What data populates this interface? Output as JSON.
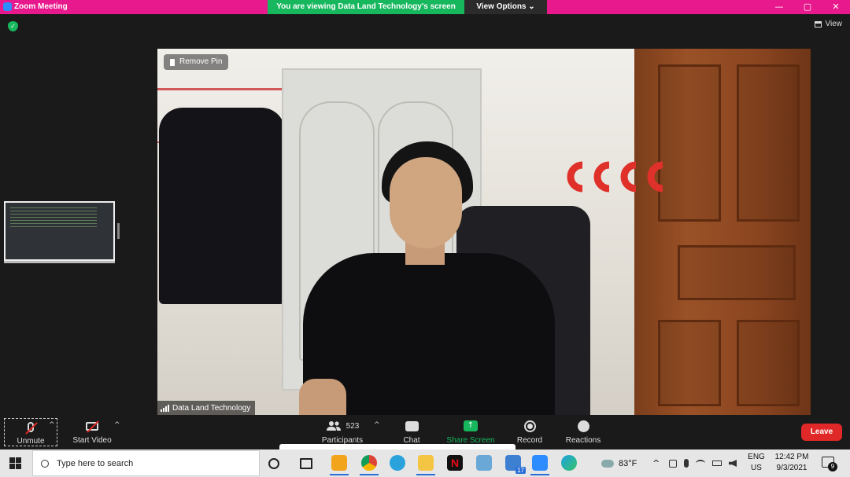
{
  "titlebar": {
    "title": "Zoom Meeting",
    "banner": "You are viewing Data Land Technology's screen",
    "view_options": "View Options",
    "view_options_caret": "⌄",
    "controls": [
      "—",
      "▢",
      "✕"
    ]
  },
  "meeting": {
    "view_label": "View",
    "remove_pin": "Remove Pin",
    "active_speaker": "Data Land Technology"
  },
  "toolbar": {
    "unmute": "Unmute",
    "start_video": "Start Video",
    "participants_count": "523",
    "participants": "Participants",
    "chat": "Chat",
    "share_screen": "Share Screen",
    "record": "Record",
    "reactions": "Reactions",
    "leave": "Leave",
    "caret": "^",
    "share_arrow": "↑"
  },
  "taskbar": {
    "search_placeholder": "Type here to search",
    "mail_badge": "17",
    "weather": "83°F",
    "lang_1": "ENG",
    "lang_2": "US",
    "time": "12:42 PM",
    "date": "9/3/2021",
    "notifications": "9",
    "tray_caret": "^"
  },
  "colors": {
    "titlebar": "#e8198c",
    "banner": "#17b75e",
    "leave": "#e02828"
  },
  "icons": [
    "zoom-app-icon",
    "shield-icon",
    "pin-icon",
    "signal-icon",
    "mic-muted-icon",
    "camera-off-icon",
    "participants-icon",
    "chat-icon",
    "share-screen-icon",
    "record-icon",
    "reactions-icon",
    "windows-start-icon",
    "search-icon"
  ]
}
